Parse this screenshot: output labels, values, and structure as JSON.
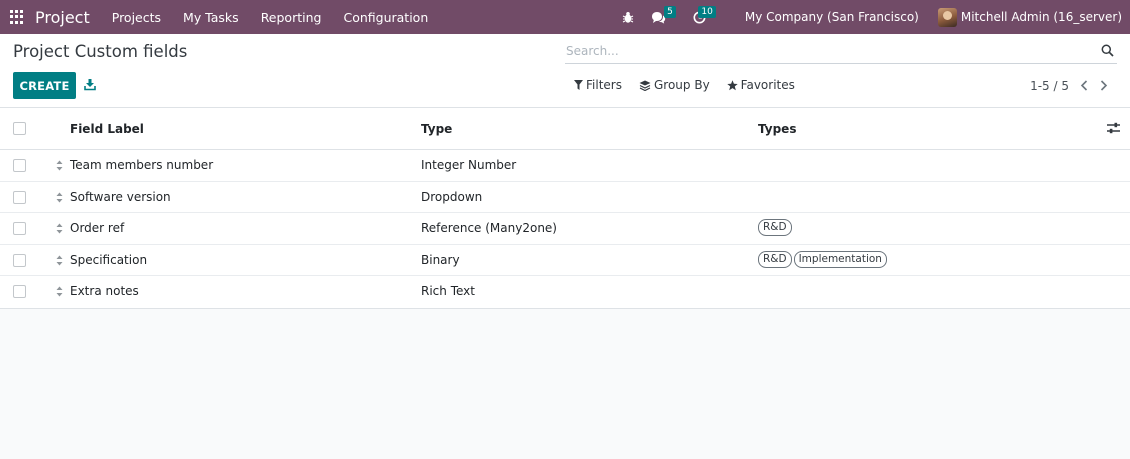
{
  "navbar": {
    "app_name": "Project",
    "menu": [
      "Projects",
      "My Tasks",
      "Reporting",
      "Configuration"
    ],
    "messages_badge": "5",
    "activities_badge": "10",
    "company": "My Company (San Francisco)",
    "user": "Mitchell Admin (16_server)"
  },
  "control_panel": {
    "title": "Project Custom fields",
    "create_label": "CREATE",
    "search_placeholder": "Search...",
    "filters_label": "Filters",
    "group_by_label": "Group By",
    "favorites_label": "Favorites",
    "pager": "1-5 / 5"
  },
  "table": {
    "headers": {
      "field_label": "Field Label",
      "type": "Type",
      "types": "Types"
    },
    "rows": [
      {
        "field_label": "Team members number",
        "type": "Integer Number",
        "tags": []
      },
      {
        "field_label": "Software version",
        "type": "Dropdown",
        "tags": []
      },
      {
        "field_label": "Order ref",
        "type": "Reference (Many2one)",
        "tags": [
          "R&D"
        ]
      },
      {
        "field_label": "Specification",
        "type": "Binary",
        "tags": [
          "R&D",
          "Implementation"
        ]
      },
      {
        "field_label": "Extra notes",
        "type": "Rich Text",
        "tags": []
      }
    ]
  },
  "colors": {
    "brand": "#714B67",
    "primary": "#017e84"
  }
}
